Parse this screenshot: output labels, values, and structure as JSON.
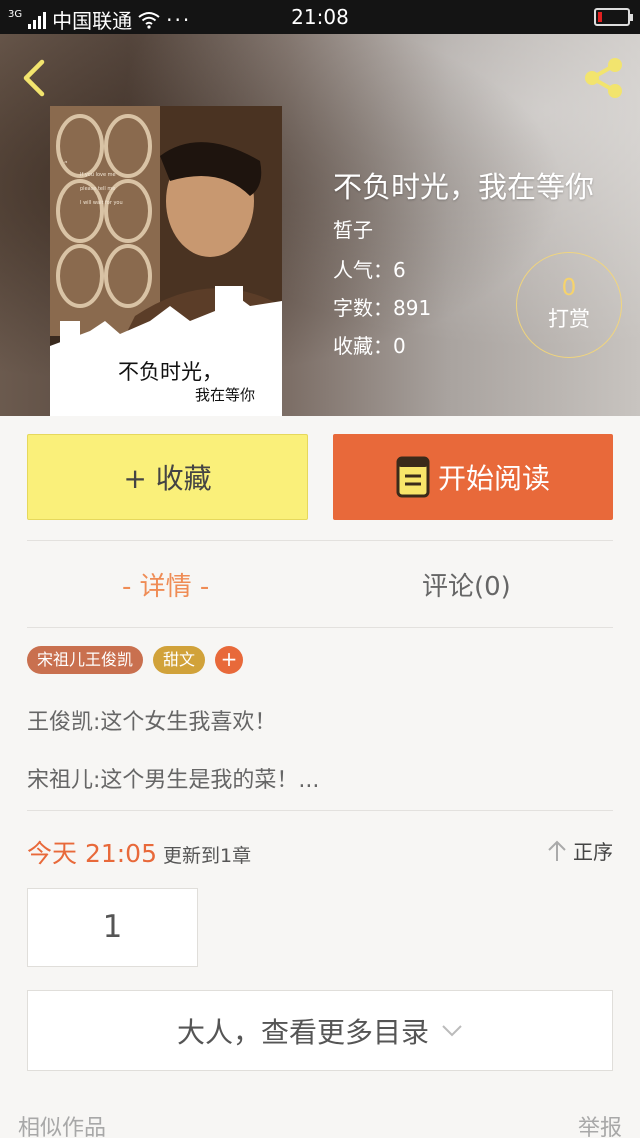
{
  "status_bar": {
    "network_tag": "3G",
    "carrier": "中国联通",
    "more": "···",
    "time": "21:08",
    "battery_level": 0.15
  },
  "book": {
    "title": "不负时光，我在等你",
    "author": "晳子",
    "popularity_label": "人气：",
    "popularity_value": "6",
    "words_label": "字数：",
    "words_value": "891",
    "favorites_label": "收藏：",
    "favorites_value": "0",
    "cover_title": "不负时光，",
    "cover_subtitle": "我在等你"
  },
  "tip": {
    "count": "0",
    "label": "打赏"
  },
  "actions": {
    "favorite_label": "+ 收藏",
    "read_label": "开始阅读"
  },
  "tabs": {
    "detail": "- 详情 -",
    "comments": "评论(0)"
  },
  "tags": [
    "宋祖儿王俊凯",
    "甜文"
  ],
  "tag_add": "+",
  "intro": [
    "王俊凯:这个女生我喜欢！",
    "宋祖儿:这个男生是我的菜！..."
  ],
  "update": {
    "time": "今天 21:05",
    "text": "更新到1章"
  },
  "sort_label": "正序",
  "chapter_number": "1",
  "more_catalog": "大人，查看更多目录",
  "footer": {
    "similar": "相似作品",
    "report": "举报"
  },
  "colors": {
    "accent": "#e8693a",
    "favorite_button": "#faf07a",
    "tab_active": "#ef8c55",
    "tip_gold": "#f6d36c"
  }
}
